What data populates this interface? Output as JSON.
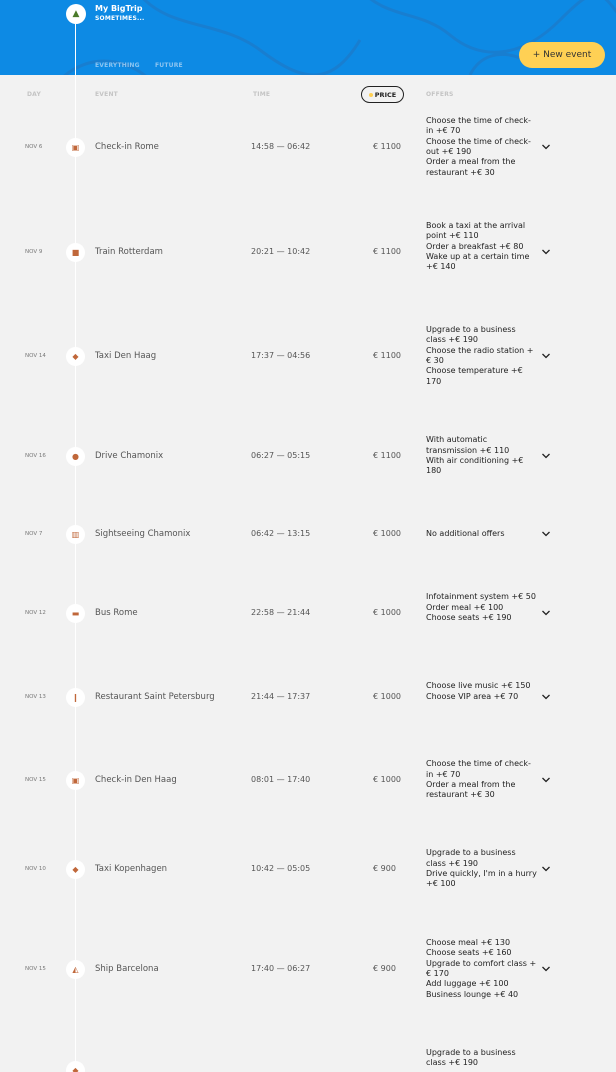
{
  "trip": {
    "title": "My BigTrip",
    "dates": "SOMETIMES...",
    "icon": "tent-icon"
  },
  "filters": [
    "EVERYTHING",
    "FUTURE"
  ],
  "new_event_label": "+ New event",
  "columns": {
    "day": "DAY",
    "event": "EVENT",
    "time": "TIME",
    "price": "PRICE",
    "offers": "OFFERS"
  },
  "colors": {
    "header": "#0d8ae4",
    "accent": "#ffd054",
    "background": "#f2f2f2"
  },
  "events": [
    {
      "day": "NOV 6",
      "icon": "hotel-icon",
      "name": "Check-in Rome",
      "time": "14:58 — 06:42",
      "price": "€ 1100",
      "offers": [
        "Choose the time of check-in +€  70",
        "Choose the time of check-out +€  190",
        "Order a meal from the restaurant +€  30"
      ]
    },
    {
      "day": "NOV 9",
      "icon": "train-icon",
      "name": "Train Rotterdam",
      "time": "20:21 — 10:42",
      "price": "€ 1100",
      "offers": [
        "Book a taxi at the arrival point +€  110",
        "Order a breakfast +€  80",
        "Wake up at a certain time +€  140"
      ]
    },
    {
      "day": "NOV 14",
      "icon": "taxi-icon",
      "name": "Taxi Den Haag",
      "time": "17:37 — 04:56",
      "price": "€ 1100",
      "offers": [
        "Upgrade to a business class +€  190",
        "Choose the radio station +€  30",
        "Choose temperature +€  170"
      ]
    },
    {
      "day": "NOV 16",
      "icon": "car-icon",
      "name": "Drive Chamonix",
      "time": "06:27 — 05:15",
      "price": "€ 1100",
      "offers": [
        "With automatic transmission +€  110",
        "With air conditioning +€  180"
      ]
    },
    {
      "day": "NOV 7",
      "icon": "sightseeing-icon",
      "name": "Sightseeing Chamonix",
      "time": "06:42 — 13:15",
      "price": "€ 1000",
      "offers": [
        "No additional offers"
      ]
    },
    {
      "day": "NOV 12",
      "icon": "bus-icon",
      "name": "Bus Rome",
      "time": "22:58 — 21:44",
      "price": "€ 1000",
      "offers": [
        "Infotainment system +€  50",
        "Order meal +€  100",
        "Choose seats +€  190"
      ]
    },
    {
      "day": "NOV 13",
      "icon": "restaurant-icon",
      "name": "Restaurant Saint Petersburg",
      "time": "21:44 — 17:37",
      "price": "€ 1000",
      "offers": [
        "Choose live music +€  150",
        "Choose VIP area +€  70"
      ]
    },
    {
      "day": "NOV 15",
      "icon": "hotel-icon",
      "name": "Check-in Den Haag",
      "time": "08:01 — 17:40",
      "price": "€ 1000",
      "offers": [
        "Choose the time of check-in +€  70",
        "Order a meal from the restaurant +€  30"
      ]
    },
    {
      "day": "NOV 10",
      "icon": "taxi-icon",
      "name": "Taxi Kopenhagen",
      "time": "10:42 — 05:05",
      "price": "€ 900",
      "offers": [
        "Upgrade to a business class +€  190",
        "Drive quickly, I'm in a hurry +€  100"
      ]
    },
    {
      "day": "NOV 15",
      "icon": "ship-icon",
      "name": "Ship Barcelona",
      "time": "17:40 — 06:27",
      "price": "€ 900",
      "offers": [
        "Choose meal +€  130",
        "Choose seats +€  160",
        "Upgrade to comfort class +€  170",
        "Add luggage +€  100",
        "Business lounge +€  40"
      ]
    },
    {
      "day": "",
      "icon": "taxi-icon",
      "name": "",
      "time": "",
      "price": "",
      "offers": [
        "Upgrade to a business class +€  190"
      ]
    }
  ]
}
